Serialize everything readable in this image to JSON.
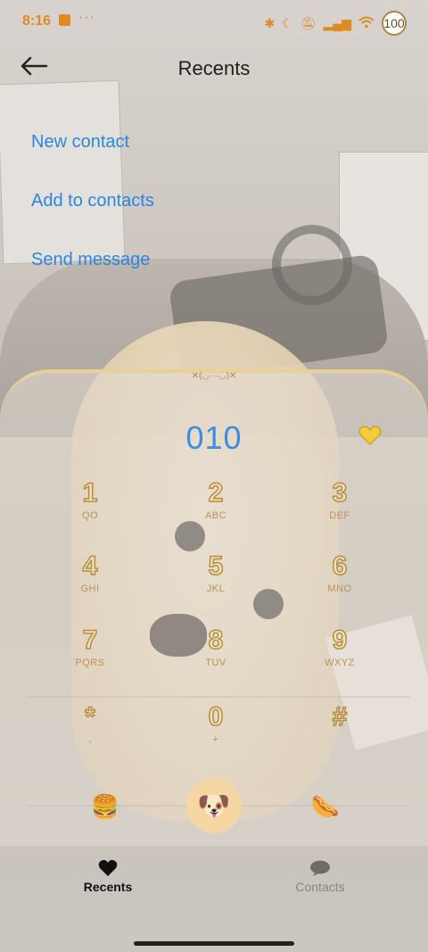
{
  "status_bar": {
    "time": "8:16",
    "more": "···",
    "battery": "100"
  },
  "header": {
    "title": "Recents"
  },
  "options": [
    {
      "label": "New contact"
    },
    {
      "label": "Add to contacts"
    },
    {
      "label": "Send message"
    }
  ],
  "dialpad": {
    "tab_label": "✕(◡···◡)✕",
    "entered_number": "010",
    "keys": [
      {
        "digit": "1",
        "letters": "QO"
      },
      {
        "digit": "2",
        "letters": "ABC"
      },
      {
        "digit": "3",
        "letters": "DEF"
      },
      {
        "digit": "4",
        "letters": "GHI"
      },
      {
        "digit": "5",
        "letters": "JKL"
      },
      {
        "digit": "6",
        "letters": "MNO"
      },
      {
        "digit": "7",
        "letters": "PQRS"
      },
      {
        "digit": "8",
        "letters": "TUV"
      },
      {
        "digit": "9",
        "letters": "WXYZ"
      },
      {
        "digit": "*",
        "letters": ","
      },
      {
        "digit": "0",
        "letters": "+"
      },
      {
        "digit": "#",
        "letters": ""
      }
    ],
    "left_action_icon": "hamburger-icon",
    "call_icon": "dog-face-icon",
    "right_action_icon": "hotdog-icon"
  },
  "bottom_nav": {
    "recents_label": "Recents",
    "contacts_label": "Contacts"
  },
  "colors": {
    "accent_blue": "#2a86e0",
    "status_orange": "#e08a23",
    "panel_border": "#e9cf9a",
    "call_button": "#f6d7a3"
  }
}
